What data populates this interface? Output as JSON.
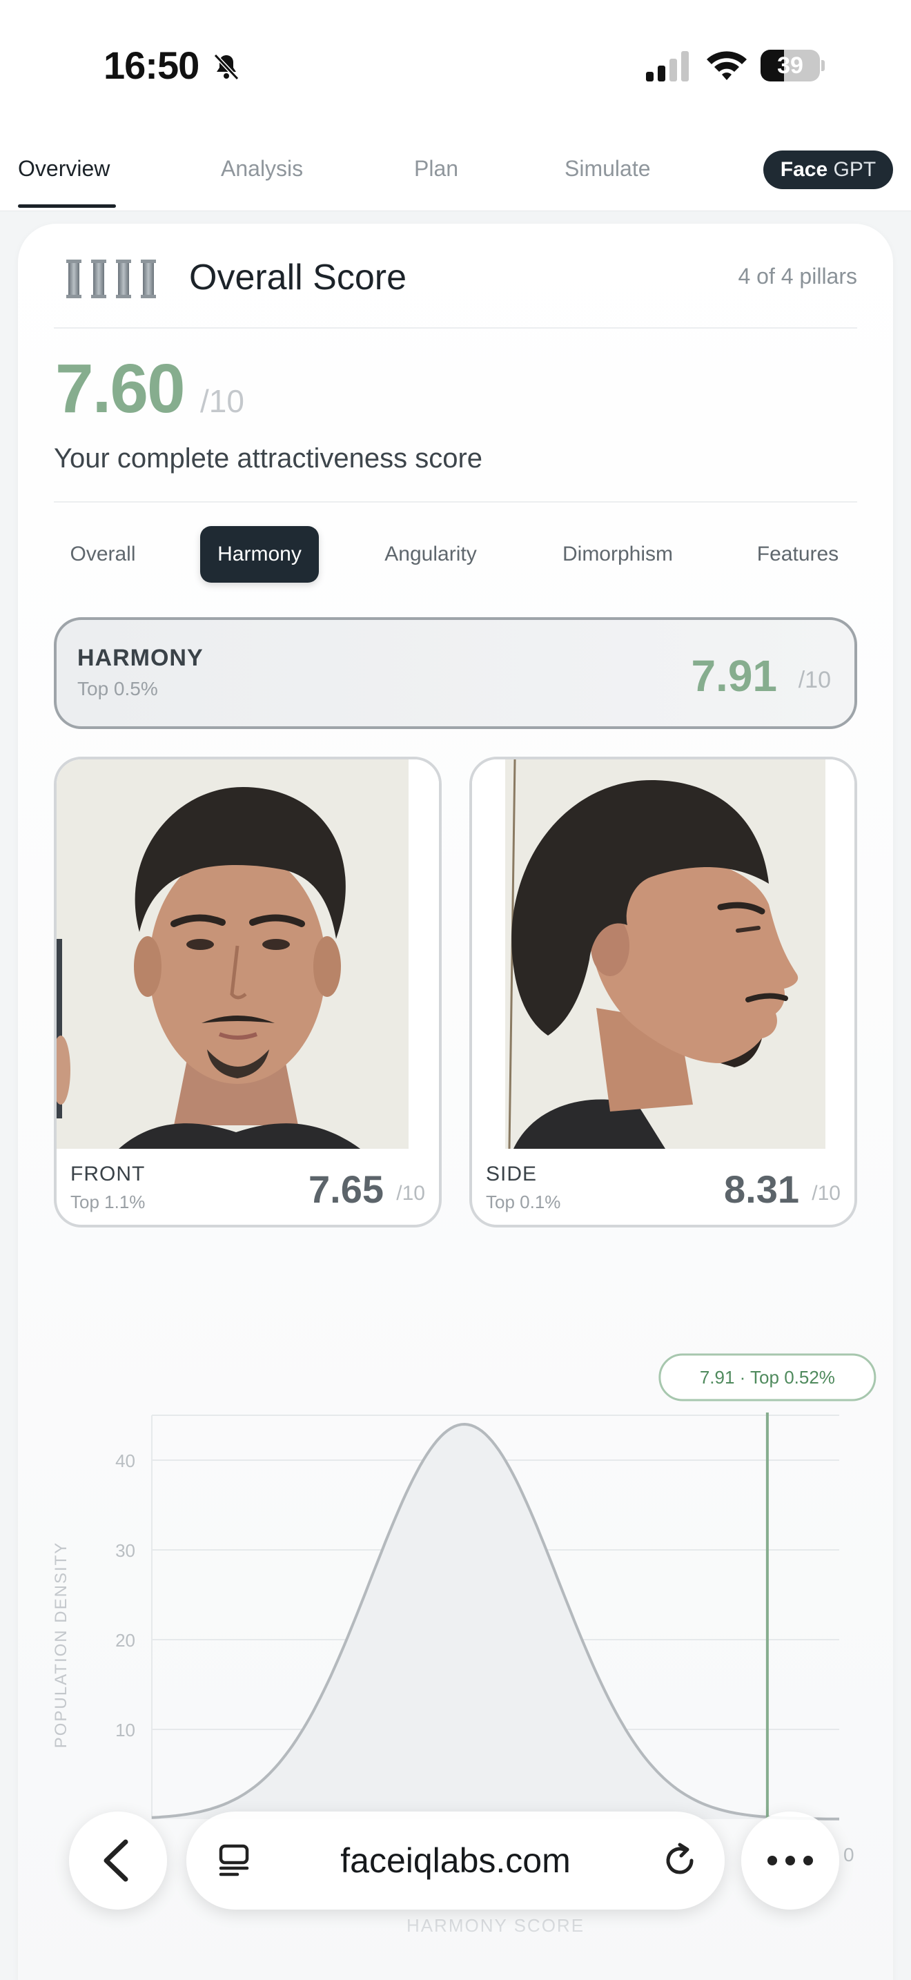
{
  "status_bar": {
    "time": "16:50",
    "battery_percent": "39",
    "battery_level": 0.39
  },
  "nav": {
    "tabs": [
      "Overview",
      "Analysis",
      "Plan",
      "Simulate"
    ],
    "active_tab": "Overview",
    "facegpt_bold": "Face",
    "facegpt_light": "GPT"
  },
  "overall": {
    "title": "Overall Score",
    "pillars_count": "4 of 4 pillars",
    "score": "7.60",
    "denominator": "/10",
    "caption": "Your complete attractiveness score"
  },
  "segments": {
    "items": [
      "Overall",
      "Harmony",
      "Angularity",
      "Dimorphism",
      "Features"
    ],
    "active": "Harmony"
  },
  "harmony": {
    "title": "HARMONY",
    "rank": "Top 0.5%",
    "score": "7.91",
    "denominator": "/10"
  },
  "photos": {
    "front": {
      "label": "FRONT",
      "rank": "Top 1.1%",
      "score": "7.65",
      "denominator": "/10"
    },
    "side": {
      "label": "SIDE",
      "rank": "Top 0.1%",
      "score": "8.31",
      "denominator": "/10"
    }
  },
  "chart_data": {
    "type": "area",
    "ylabel": "POPULATION DENSITY",
    "xlabel": "HARMONY SCORE",
    "y_ticks": [
      "10",
      "20",
      "30",
      "40"
    ],
    "ylim": [
      0,
      45
    ],
    "grid": true,
    "curve": {
      "mean": 5.0,
      "sd": 0.9,
      "peak": 44,
      "xlim": [
        2.0,
        8.6
      ]
    },
    "marker": {
      "x": 7.91,
      "label": "7.91 · Top 0.52%"
    },
    "partial_tick_label": "0"
  },
  "browser": {
    "url": "faceiqlabs.com"
  },
  "colors": {
    "accent_green": "#86ad8e",
    "dark": "#1f2a33"
  }
}
